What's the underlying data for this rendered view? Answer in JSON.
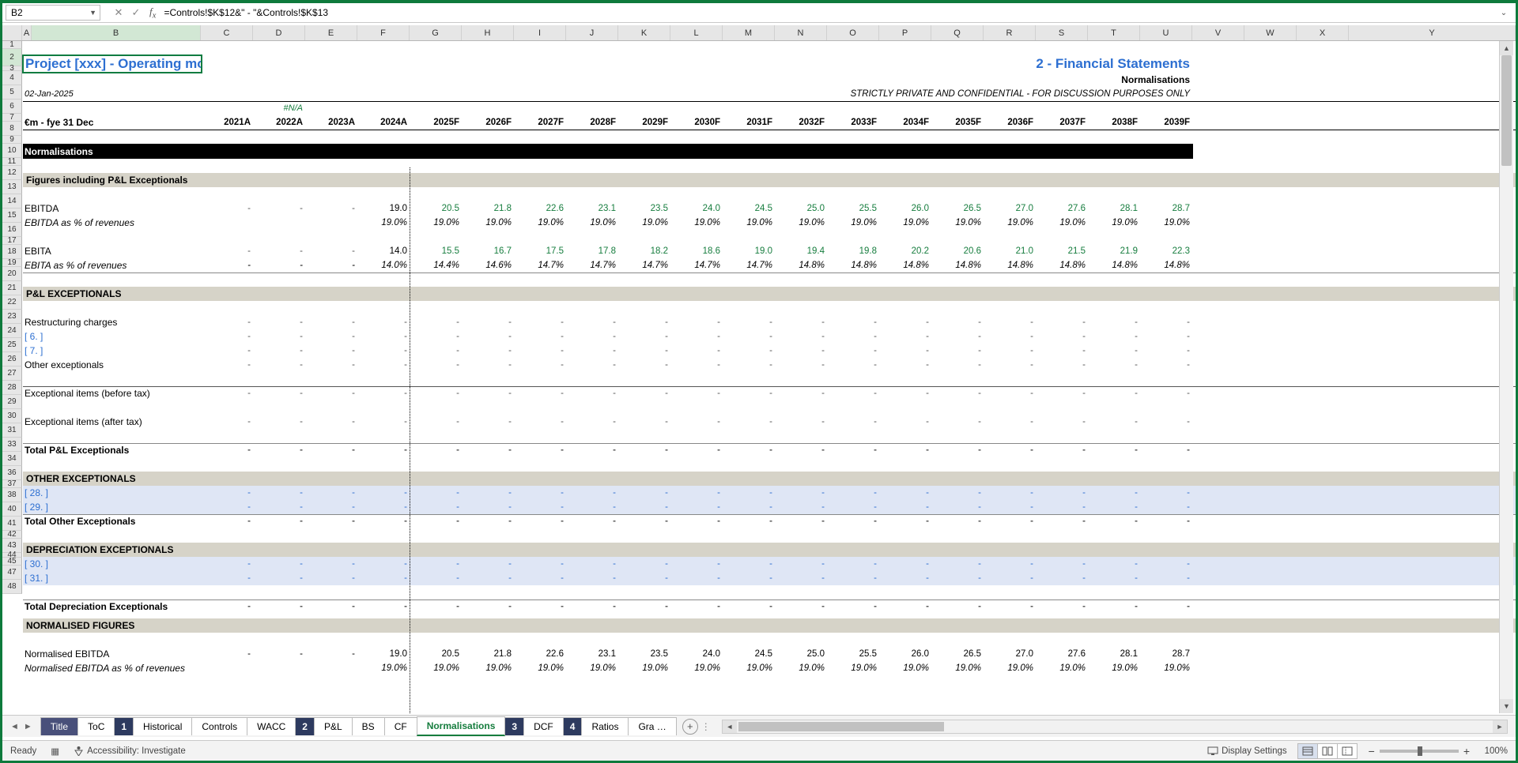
{
  "formula_bar": {
    "cell_ref": "B2",
    "formula": "=Controls!$K$12&\" - \"&Controls!$K$13"
  },
  "header": {
    "title": "Project [xxx] - Operating model",
    "section": "2 - Financial Statements",
    "subtitle": "Normalisations",
    "date": "02-Jan-2025",
    "conf": "STRICTLY PRIVATE AND CONFIDENTIAL - FOR DISCUSSION PURPOSES ONLY",
    "na": "#N/A",
    "unit": "€m - fye 31 Dec"
  },
  "col_letters": [
    "A",
    "B",
    "C",
    "D",
    "E",
    "F",
    "G",
    "H",
    "I",
    "J",
    "K",
    "L",
    "M",
    "N",
    "O",
    "P",
    "Q",
    "R",
    "S",
    "T",
    "U",
    "V",
    "W",
    "X",
    "Y"
  ],
  "row_numbers": [
    "1",
    "2",
    "3",
    "4",
    "5",
    "6",
    "7",
    "8",
    "9",
    "10",
    "11",
    "12",
    "13",
    "14",
    "15",
    "16",
    "17",
    "18",
    "19",
    "20",
    "21",
    "22",
    "23",
    "24",
    "25",
    "26",
    "27",
    "28",
    "29",
    "30",
    "31",
    "33",
    "34",
    "36",
    "37",
    "38",
    "40",
    "41",
    "42",
    "43",
    "44",
    "45",
    "47",
    "48"
  ],
  "years": [
    "2021A",
    "2022A",
    "2023A",
    "2024A",
    "2025F",
    "2026F",
    "2027F",
    "2028F",
    "2029F",
    "2030F",
    "2031F",
    "2032F",
    "2033F",
    "2034F",
    "2035F",
    "2036F",
    "2037F",
    "2038F",
    "2039F"
  ],
  "rows": {
    "normalisations": "Normalisations",
    "fig_header": "Figures including P&L Exceptionals",
    "ebitda": "EBITDA",
    "ebitda_pct": "EBITDA as % of revenues",
    "ebita": "EBITA",
    "ebita_pct": "EBITA as % of revenues",
    "pl_exc": "P&L EXCEPTIONALS",
    "restr": "Restructuring charges",
    "r6": "[ 6. ]",
    "r7": "[ 7. ]",
    "other_exc": "Other exceptionals",
    "exc_before": "Exceptional items (before tax)",
    "exc_after": "Exceptional items (after tax)",
    "total_pl": "Total P&L Exceptionals",
    "other_exc_h": "OTHER EXCEPTIONALS",
    "r28": "[ 28. ]",
    "r29": "[ 29. ]",
    "total_other": "Total Other Exceptionals",
    "dep_exc": "DEPRECIATION EXCEPTIONALS",
    "r30": "[ 30. ]",
    "r31": "[ 31. ]",
    "total_dep": "Total Depreciation Exceptionals",
    "norm_fig": "NORMALISED FIGURES",
    "norm_ebitda": "Normalised EBITDA",
    "norm_ebitda_pct": "Normalised EBITDA as % of revenues"
  },
  "vals": {
    "ebitda": [
      "-",
      "-",
      "-",
      "19.0",
      "20.5",
      "21.8",
      "22.6",
      "23.1",
      "23.5",
      "24.0",
      "24.5",
      "25.0",
      "25.5",
      "26.0",
      "26.5",
      "27.0",
      "27.6",
      "28.1",
      "28.7"
    ],
    "ebitda_pct": [
      "",
      "",
      "",
      "19.0%",
      "19.0%",
      "19.0%",
      "19.0%",
      "19.0%",
      "19.0%",
      "19.0%",
      "19.0%",
      "19.0%",
      "19.0%",
      "19.0%",
      "19.0%",
      "19.0%",
      "19.0%",
      "19.0%",
      "19.0%"
    ],
    "ebita": [
      "-",
      "-",
      "-",
      "14.0",
      "15.5",
      "16.7",
      "17.5",
      "17.8",
      "18.2",
      "18.6",
      "19.0",
      "19.4",
      "19.8",
      "20.2",
      "20.6",
      "21.0",
      "21.5",
      "21.9",
      "22.3"
    ],
    "ebita_pct": [
      "-",
      "-",
      "-",
      "14.0%",
      "14.4%",
      "14.6%",
      "14.7%",
      "14.7%",
      "14.7%",
      "14.7%",
      "14.7%",
      "14.8%",
      "14.8%",
      "14.8%",
      "14.8%",
      "14.8%",
      "14.8%",
      "14.8%",
      "14.8%"
    ],
    "dashes": [
      "-",
      "-",
      "-",
      "-",
      "-",
      "-",
      "-",
      "-",
      "-",
      "-",
      "-",
      "-",
      "-",
      "-",
      "-",
      "-",
      "-",
      "-",
      "-"
    ],
    "norm_ebitda": [
      "-",
      "-",
      "-",
      "19.0",
      "20.5",
      "21.8",
      "22.6",
      "23.1",
      "23.5",
      "24.0",
      "24.5",
      "25.0",
      "25.5",
      "26.0",
      "26.5",
      "27.0",
      "27.6",
      "28.1",
      "28.7"
    ],
    "norm_ebitda_pct": [
      "",
      "",
      "",
      "19.0%",
      "19.0%",
      "19.0%",
      "19.0%",
      "19.0%",
      "19.0%",
      "19.0%",
      "19.0%",
      "19.0%",
      "19.0%",
      "19.0%",
      "19.0%",
      "19.0%",
      "19.0%",
      "19.0%",
      "19.0%"
    ]
  },
  "tabs": [
    "Title",
    "ToC",
    "1",
    "Historical",
    "Controls",
    "WACC",
    "2",
    "P&L",
    "BS",
    "CF",
    "Normalisations",
    "3",
    "DCF",
    "4",
    "Ratios",
    "Gra …"
  ],
  "status": {
    "ready": "Ready",
    "acc": "Accessibility: Investigate",
    "disp": "Display Settings",
    "zoom": "100%"
  }
}
